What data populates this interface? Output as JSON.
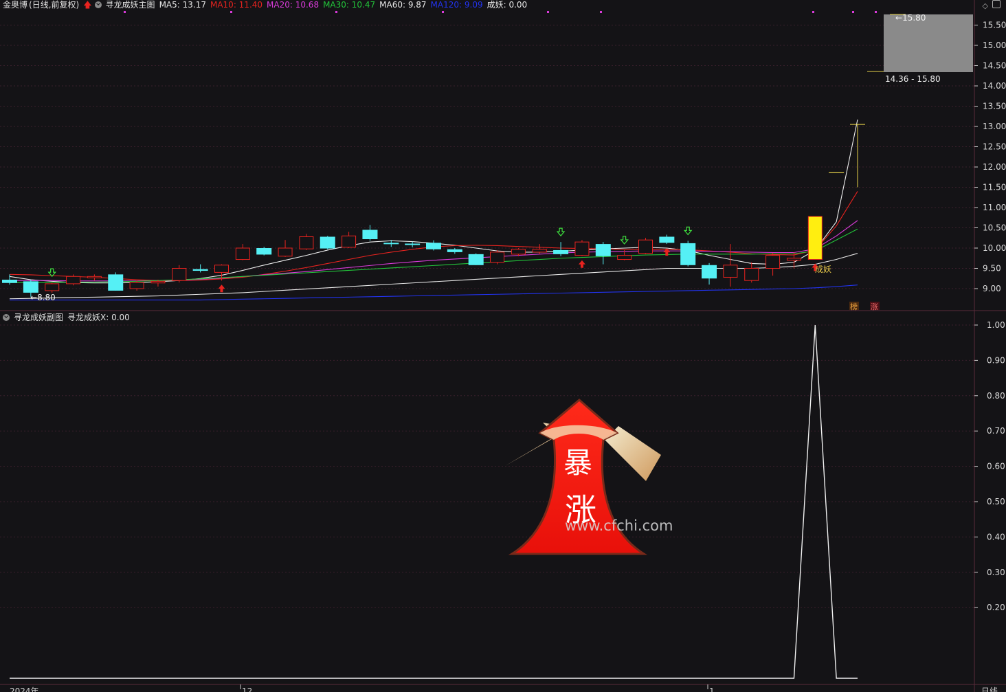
{
  "header": {
    "stock_name": "金奥博",
    "period": "(日线,前复权)",
    "indicator_name": "寻龙成妖主图",
    "ma_labels": [
      {
        "text": "MA5: 13.17",
        "color": "#e8e8e8"
      },
      {
        "text": "MA10: 11.40",
        "color": "#e8231f"
      },
      {
        "text": "MA20: 10.68",
        "color": "#d93bd9"
      },
      {
        "text": "MA30: 10.47",
        "color": "#22c33a"
      },
      {
        "text": "MA60: 9.87",
        "color": "#e8e8e8"
      },
      {
        "text": "MA120: 9.09",
        "color": "#2233ee"
      },
      {
        "text": "成妖: 0.00",
        "color": "#e8e8e8"
      }
    ]
  },
  "sub_header": {
    "indicator_name": "寻龙成妖副图",
    "value_label": "寻龙成妖X: 0.00"
  },
  "annotations": {
    "low_marker": "8.80",
    "high_marker": "15.80",
    "range_label": "14.36 - 15.80",
    "signal_text": "成妖",
    "badge_1": "榜",
    "badge_2": "涨",
    "watermark": "www.cfchi.com",
    "logo_text_1": "暴",
    "logo_text_2": "涨"
  },
  "x_axis": {
    "labels": [
      "2024年",
      "12",
      "1"
    ],
    "period_label": "日线"
  },
  "colors": {
    "up": "#e8231f",
    "down": "#55f0f5",
    "background": "#141316",
    "grid": "#3a1f2c"
  },
  "chart_data": [
    {
      "type": "candlestick",
      "title": "寻龙成妖主图",
      "ylim": [
        8.7,
        15.8
      ],
      "y_ticks": [
        9.0,
        9.5,
        10.0,
        10.5,
        11.0,
        11.5,
        12.0,
        12.5,
        13.0,
        13.5,
        14.0,
        14.5,
        15.0,
        15.5
      ],
      "candles": [
        {
          "o": 9.22,
          "h": 9.35,
          "l": 9.1,
          "c": 9.14
        },
        {
          "o": 9.18,
          "h": 9.22,
          "l": 8.8,
          "c": 8.9
        },
        {
          "o": 8.95,
          "h": 9.15,
          "l": 8.9,
          "c": 9.12
        },
        {
          "o": 9.12,
          "h": 9.35,
          "l": 9.08,
          "c": 9.3
        },
        {
          "o": 9.28,
          "h": 9.35,
          "l": 9.2,
          "c": 9.3
        },
        {
          "o": 9.35,
          "h": 9.4,
          "l": 8.95,
          "c": 8.95
        },
        {
          "o": 9.0,
          "h": 9.2,
          "l": 8.95,
          "c": 9.15
        },
        {
          "o": 9.14,
          "h": 9.22,
          "l": 9.05,
          "c": 9.18
        },
        {
          "o": 9.2,
          "h": 9.58,
          "l": 9.15,
          "c": 9.5
        },
        {
          "o": 9.48,
          "h": 9.6,
          "l": 9.4,
          "c": 9.44
        },
        {
          "o": 9.4,
          "h": 9.6,
          "l": 9.2,
          "c": 9.58
        },
        {
          "o": 9.72,
          "h": 10.1,
          "l": 9.7,
          "c": 10.0
        },
        {
          "o": 10.0,
          "h": 10.03,
          "l": 9.82,
          "c": 9.84
        },
        {
          "o": 9.8,
          "h": 10.2,
          "l": 9.78,
          "c": 10.0
        },
        {
          "o": 9.98,
          "h": 10.35,
          "l": 9.95,
          "c": 10.28
        },
        {
          "o": 10.28,
          "h": 10.3,
          "l": 9.97,
          "c": 9.99
        },
        {
          "o": 10.02,
          "h": 10.4,
          "l": 10.0,
          "c": 10.3
        },
        {
          "o": 10.45,
          "h": 10.57,
          "l": 10.18,
          "c": 10.22
        },
        {
          "o": 10.13,
          "h": 10.2,
          "l": 10.03,
          "c": 10.1
        },
        {
          "o": 10.11,
          "h": 10.16,
          "l": 10.02,
          "c": 10.09
        },
        {
          "o": 10.13,
          "h": 10.19,
          "l": 9.94,
          "c": 9.97
        },
        {
          "o": 9.97,
          "h": 10.0,
          "l": 9.86,
          "c": 9.9
        },
        {
          "o": 9.85,
          "h": 9.87,
          "l": 9.58,
          "c": 9.58
        },
        {
          "o": 9.65,
          "h": 9.95,
          "l": 9.6,
          "c": 9.9
        },
        {
          "o": 9.85,
          "h": 10.0,
          "l": 9.8,
          "c": 9.97
        },
        {
          "o": 9.9,
          "h": 10.1,
          "l": 9.85,
          "c": 9.97
        },
        {
          "o": 9.95,
          "h": 10.15,
          "l": 9.8,
          "c": 9.85
        },
        {
          "o": 9.82,
          "h": 10.2,
          "l": 9.8,
          "c": 10.15
        },
        {
          "o": 10.1,
          "h": 10.15,
          "l": 9.6,
          "c": 9.8
        },
        {
          "o": 9.72,
          "h": 9.95,
          "l": 9.7,
          "c": 9.82
        },
        {
          "o": 9.87,
          "h": 10.25,
          "l": 9.85,
          "c": 10.2
        },
        {
          "o": 10.28,
          "h": 10.33,
          "l": 10.1,
          "c": 10.13
        },
        {
          "o": 10.12,
          "h": 10.18,
          "l": 9.55,
          "c": 9.58
        },
        {
          "o": 9.58,
          "h": 9.63,
          "l": 9.1,
          "c": 9.25
        },
        {
          "o": 9.28,
          "h": 10.1,
          "l": 9.05,
          "c": 9.58
        },
        {
          "o": 9.2,
          "h": 9.65,
          "l": 9.15,
          "c": 9.5
        },
        {
          "o": 9.5,
          "h": 9.88,
          "l": 9.32,
          "c": 9.82
        },
        {
          "o": 9.7,
          "h": 9.9,
          "l": 9.5,
          "c": 9.75
        },
        {
          "o": 9.72,
          "h": 10.78,
          "l": 9.72,
          "c": 10.78
        },
        {
          "o": 11.86,
          "h": 11.86,
          "l": 11.86,
          "c": 11.86
        },
        {
          "o": 13.05,
          "h": 13.05,
          "l": 11.5,
          "c": 13.05
        }
      ],
      "series": [
        {
          "name": "MA5",
          "color": "#f0f0f0",
          "values": [
            9.3,
            9.22,
            9.18,
            9.15,
            9.14,
            9.14,
            9.15,
            9.17,
            9.2,
            9.25,
            9.33,
            9.45,
            9.58,
            9.7,
            9.82,
            9.95,
            10.06,
            10.15,
            10.18,
            10.16,
            10.12,
            10.07,
            10.0,
            9.93,
            9.9,
            9.9,
            9.92,
            9.95,
            9.98,
            10.0,
            10.02,
            10.0,
            9.94,
            9.82,
            9.72,
            9.62,
            9.6,
            9.65,
            9.95,
            10.65,
            13.17
          ]
        },
        {
          "name": "MA10",
          "color": "#e8231f",
          "values": [
            9.35,
            9.34,
            9.32,
            9.3,
            9.28,
            9.25,
            9.22,
            9.2,
            9.2,
            9.21,
            9.24,
            9.28,
            9.35,
            9.43,
            9.52,
            9.62,
            9.72,
            9.82,
            9.9,
            9.97,
            10.03,
            10.06,
            10.07,
            10.06,
            10.04,
            10.02,
            10.0,
            9.99,
            9.98,
            9.97,
            9.97,
            9.97,
            9.96,
            9.93,
            9.9,
            9.86,
            9.84,
            9.83,
            9.95,
            10.55,
            11.4
          ]
        },
        {
          "name": "MA20",
          "color": "#d93bd9",
          "values": [
            9.2,
            9.2,
            9.2,
            9.19,
            9.19,
            9.19,
            9.19,
            9.2,
            9.21,
            9.23,
            9.26,
            9.3,
            9.34,
            9.38,
            9.42,
            9.47,
            9.52,
            9.57,
            9.62,
            9.66,
            9.7,
            9.73,
            9.76,
            9.79,
            9.82,
            9.85,
            9.88,
            9.9,
            9.91,
            9.92,
            9.93,
            9.93,
            9.93,
            9.92,
            9.91,
            9.9,
            9.89,
            9.89,
            9.98,
            10.3,
            10.68
          ]
        },
        {
          "name": "MA30",
          "color": "#22c33a",
          "values": [
            9.15,
            9.15,
            9.15,
            9.16,
            9.16,
            9.17,
            9.18,
            9.2,
            9.22,
            9.24,
            9.27,
            9.3,
            9.33,
            9.36,
            9.39,
            9.42,
            9.45,
            9.48,
            9.51,
            9.54,
            9.57,
            9.6,
            9.63,
            9.66,
            9.69,
            9.72,
            9.75,
            9.77,
            9.79,
            9.81,
            9.83,
            9.84,
            9.85,
            9.85,
            9.85,
            9.85,
            9.86,
            9.86,
            9.93,
            10.2,
            10.47
          ]
        },
        {
          "name": "MA60",
          "color": "#e8e8e8",
          "values": [
            8.75,
            8.76,
            8.77,
            8.78,
            8.79,
            8.8,
            8.81,
            8.82,
            8.84,
            8.86,
            8.88,
            8.9,
            8.93,
            8.96,
            8.99,
            9.02,
            9.05,
            9.08,
            9.11,
            9.14,
            9.17,
            9.2,
            9.23,
            9.26,
            9.29,
            9.32,
            9.35,
            9.38,
            9.41,
            9.44,
            9.47,
            9.5,
            9.5,
            9.5,
            9.5,
            9.5,
            9.52,
            9.55,
            9.6,
            9.72,
            9.87
          ]
        },
        {
          "name": "MA120",
          "color": "#2233ee",
          "values": [
            8.72,
            8.72,
            8.72,
            8.72,
            8.72,
            8.72,
            8.72,
            8.72,
            8.72,
            8.72,
            8.73,
            8.74,
            8.75,
            8.76,
            8.77,
            8.78,
            8.79,
            8.8,
            8.81,
            8.82,
            8.83,
            8.84,
            8.85,
            8.86,
            8.87,
            8.88,
            8.89,
            8.9,
            8.91,
            8.92,
            8.93,
            8.94,
            8.95,
            8.96,
            8.97,
            8.98,
            8.99,
            9.0,
            9.02,
            9.05,
            9.09
          ]
        }
      ],
      "buy_signals": [
        10,
        27,
        31,
        38
      ],
      "sell_signals": [
        2,
        26,
        29,
        32
      ]
    },
    {
      "type": "line",
      "title": "寻龙成妖副图",
      "ylim": [
        0,
        1.0
      ],
      "y_ticks": [
        0.2,
        0.3,
        0.4,
        0.5,
        0.6,
        0.7,
        0.8,
        0.9,
        1.0
      ],
      "series": [
        {
          "name": "寻龙成妖X",
          "color": "#f0f0f0",
          "values": [
            0,
            0,
            0,
            0,
            0,
            0,
            0,
            0,
            0,
            0,
            0,
            0,
            0,
            0,
            0,
            0,
            0,
            0,
            0,
            0,
            0,
            0,
            0,
            0,
            0,
            0,
            0,
            0,
            0,
            0,
            0,
            0,
            0,
            0,
            0,
            0,
            0,
            0,
            1,
            0,
            0
          ]
        }
      ]
    }
  ]
}
